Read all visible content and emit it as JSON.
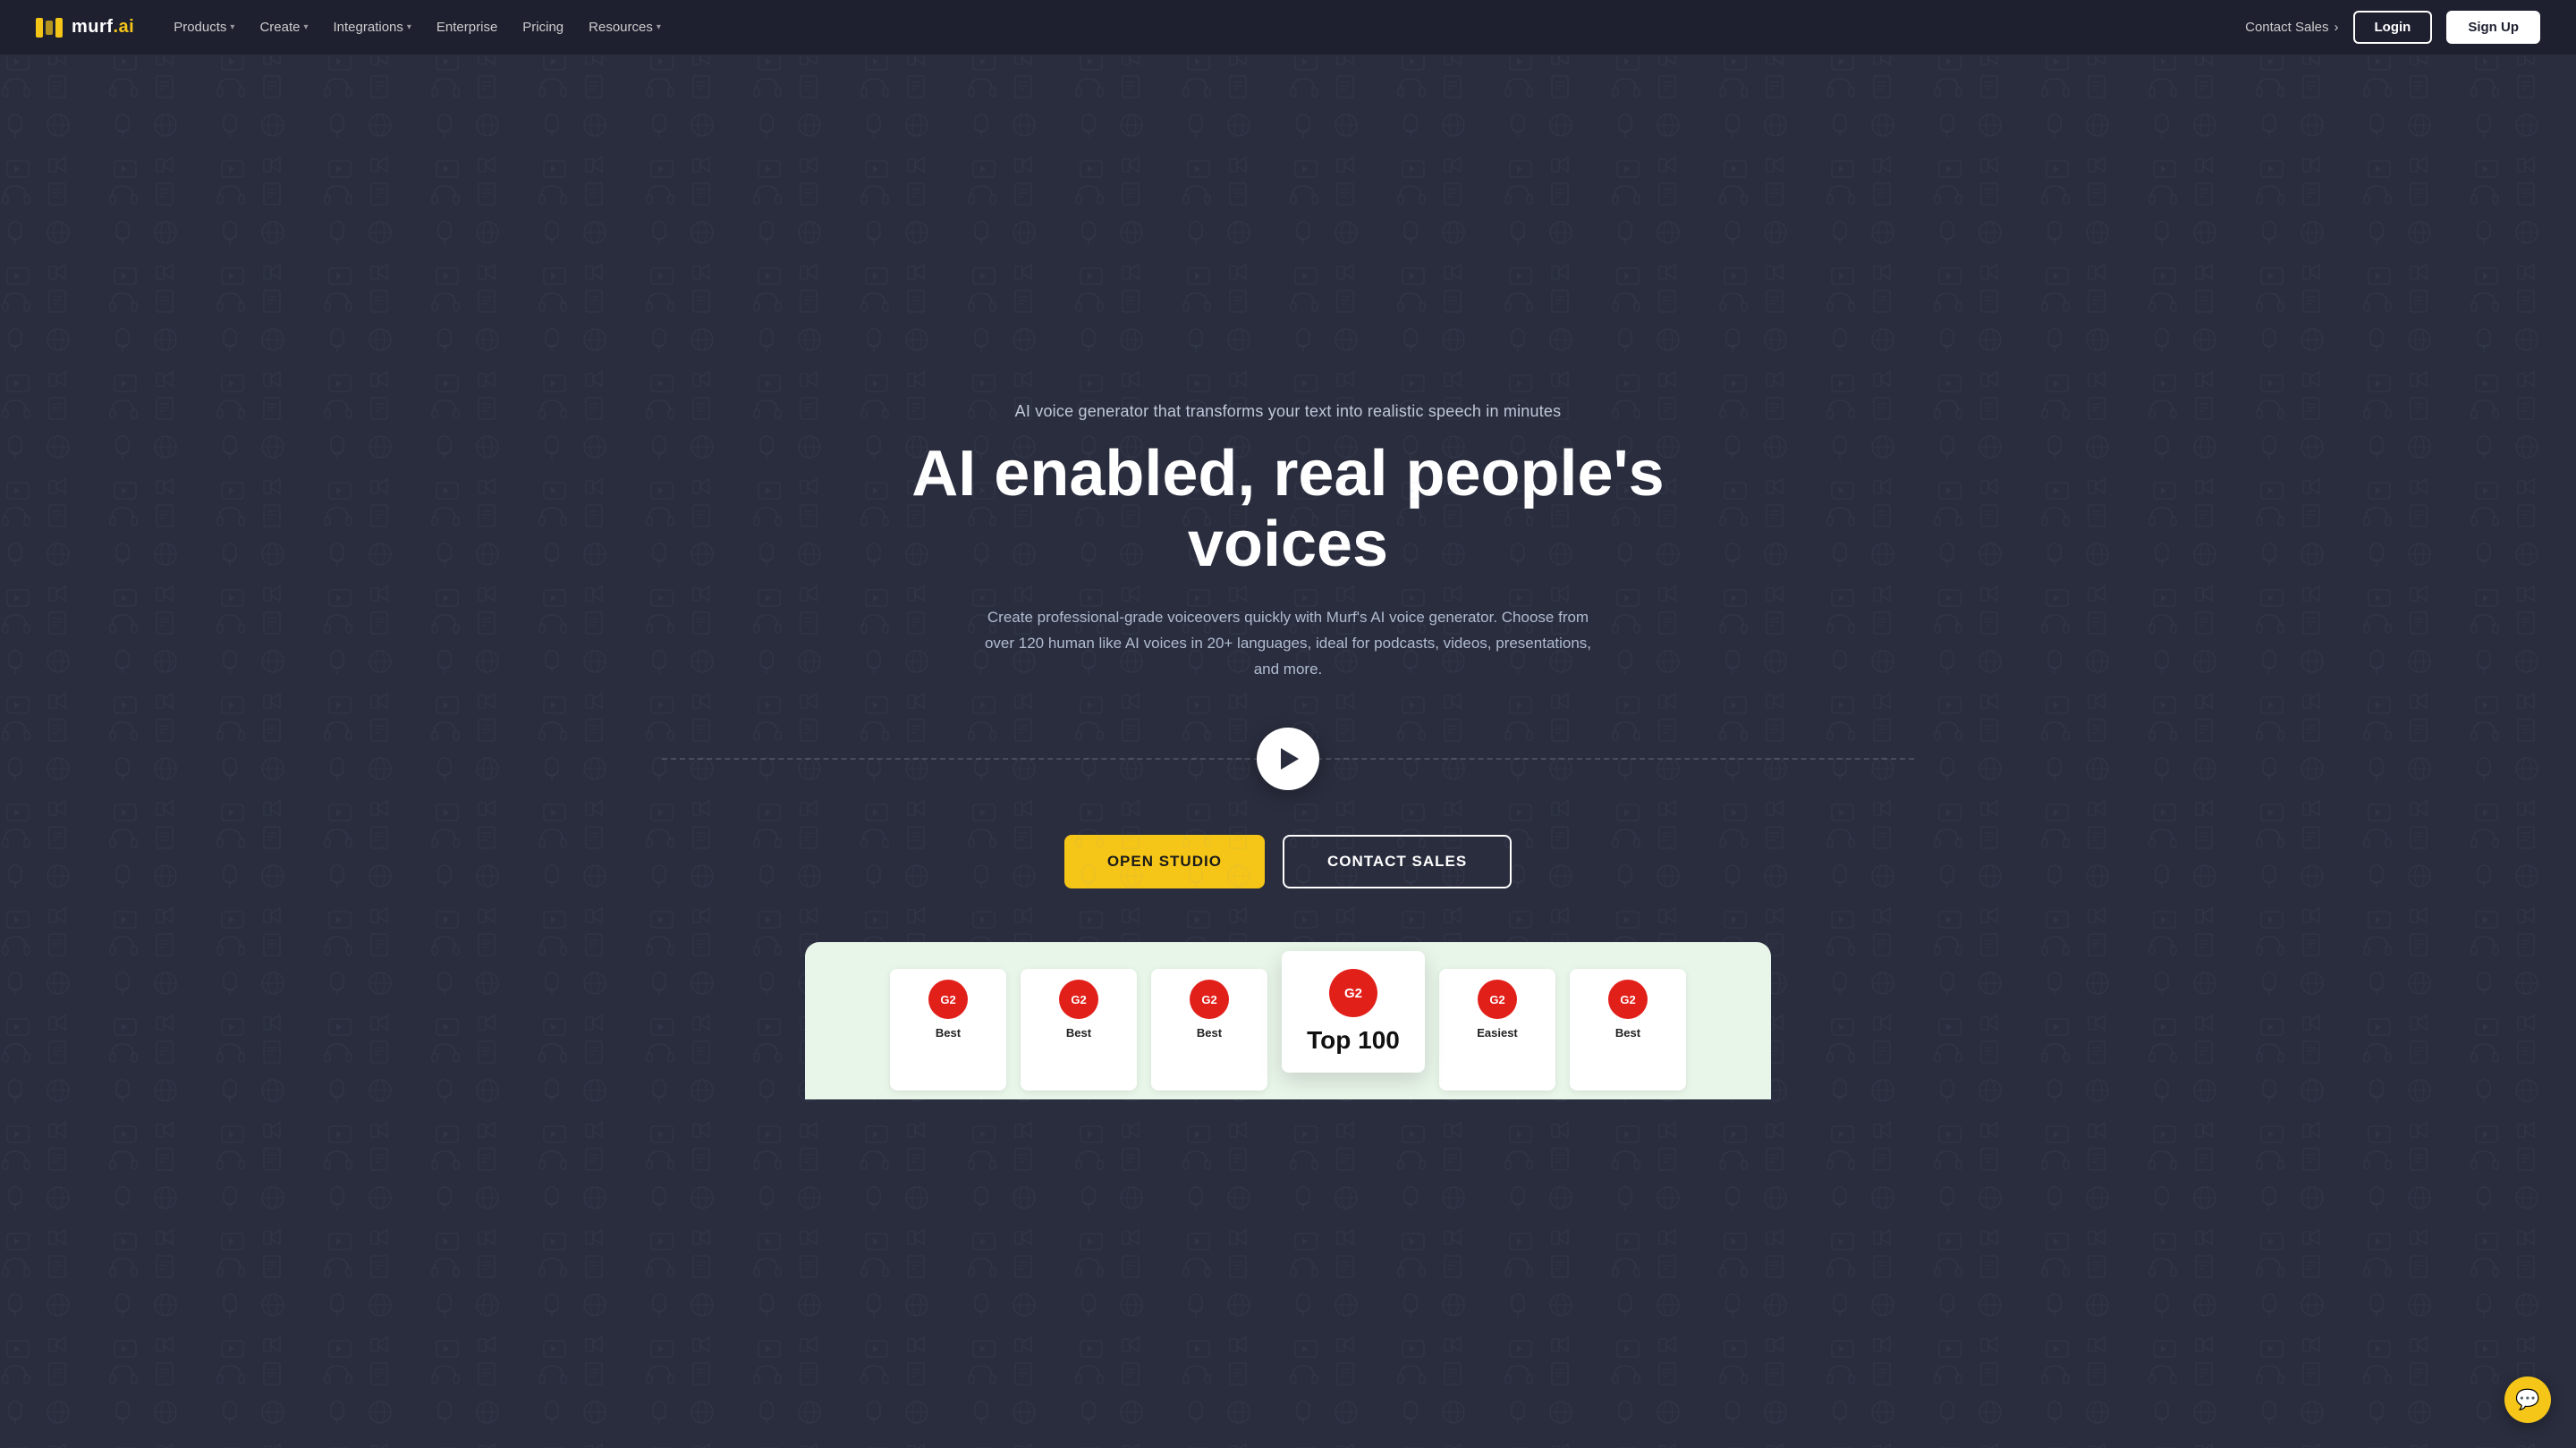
{
  "brand": {
    "name": "MURF.AI",
    "logo_text": "murf",
    "logo_suffix": ".ai"
  },
  "navbar": {
    "contact_sales_label": "Contact Sales",
    "login_label": "Login",
    "signup_label": "Sign Up",
    "nav_items": [
      {
        "id": "products",
        "label": "Products",
        "has_dropdown": true
      },
      {
        "id": "create",
        "label": "Create",
        "has_dropdown": true
      },
      {
        "id": "integrations",
        "label": "Integrations",
        "has_dropdown": true
      },
      {
        "id": "enterprise",
        "label": "Enterprise",
        "has_dropdown": false
      },
      {
        "id": "pricing",
        "label": "Pricing",
        "has_dropdown": false
      },
      {
        "id": "resources",
        "label": "Resources",
        "has_dropdown": true
      }
    ]
  },
  "hero": {
    "subtitle": "AI voice generator that transforms your text into realistic speech in minutes",
    "title": "AI enabled, real people's voices",
    "description": "Create professional-grade voiceovers quickly with Murf's AI voice generator. Choose from over 120 human like AI voices in 20+ languages, ideal for podcasts, videos, presentations, and more.",
    "cta_primary": "OPEN STUDIO",
    "cta_secondary": "CONTACT SALES"
  },
  "awards": [
    {
      "id": "1",
      "badge": "G2",
      "title": "Best",
      "subtitle": "",
      "featured": false
    },
    {
      "id": "2",
      "badge": "G2",
      "title": "Best",
      "subtitle": "",
      "featured": false
    },
    {
      "id": "3",
      "badge": "G2",
      "title": "Best",
      "subtitle": "",
      "featured": false
    },
    {
      "id": "4",
      "badge": "G2",
      "title": "Top 100",
      "subtitle": "",
      "featured": true
    },
    {
      "id": "5",
      "badge": "G2",
      "title": "Easiest",
      "subtitle": "",
      "featured": false
    },
    {
      "id": "6",
      "badge": "G2",
      "title": "",
      "subtitle": "",
      "featured": false
    }
  ],
  "chat": {
    "icon": "💬"
  }
}
